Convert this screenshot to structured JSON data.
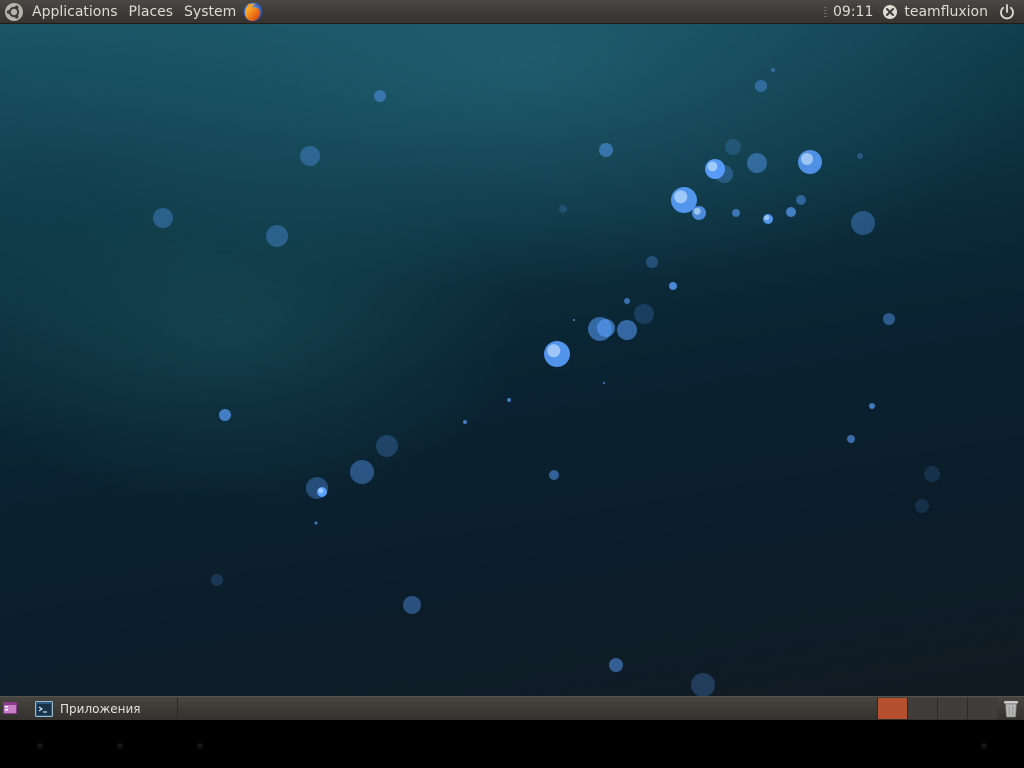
{
  "top_panel": {
    "menus": {
      "applications": "Applications",
      "places": "Places",
      "system": "System"
    },
    "icons": {
      "main_menu": "ubuntu-logo-icon",
      "browser_launcher": "firefox-icon",
      "status": "network-disconnected-icon",
      "session": "power-icon"
    },
    "clock": "09:11",
    "username": "teamfluxion"
  },
  "desktop": {
    "wallpaper_colors": [
      "#1a5566",
      "#0a2433",
      "#111a22"
    ],
    "bubble_color": "#5aa0ff"
  },
  "bottom_panel": {
    "show_desktop_icon": "show-desktop-icon",
    "task": {
      "icon": "terminal-window-icon",
      "label": "Приложения"
    },
    "workspaces": {
      "count": 4,
      "active_index": 0,
      "active_color": "#b4502e"
    },
    "trash_icon": "trash-icon"
  }
}
